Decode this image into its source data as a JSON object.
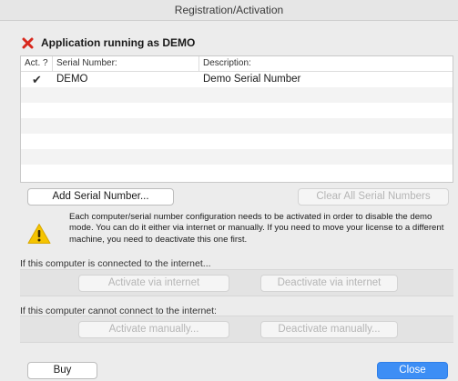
{
  "window": {
    "title": "Registration/Activation"
  },
  "status": {
    "text": "Application running as DEMO",
    "icon": "red-x-icon",
    "icon_color": "#d8281d"
  },
  "table": {
    "headers": {
      "act": "Act. ?",
      "serial": "Serial Number:",
      "description": "Description:"
    },
    "rows": [
      {
        "act": "✔",
        "serial": "DEMO",
        "description": "Demo Serial Number"
      }
    ]
  },
  "buttons": {
    "add_serial": "Add Serial Number...",
    "clear_all": "Clear All Serial Numbers",
    "activate_internet": "Activate via internet",
    "deactivate_internet": "Deactivate via internet",
    "activate_manually": "Activate manually...",
    "deactivate_manually": "Deactivate manually...",
    "buy": "Buy",
    "close": "Close"
  },
  "info": {
    "icon": "warning-icon",
    "text": "Each computer/serial number configuration needs to be activated in order to disable the demo mode. You can do it either via internet or manually. If you need to move your license to a different machine, you need to deactivate this one first."
  },
  "sections": {
    "internet": "If this computer is connected to the internet...",
    "manual": "If this computer cannot connect to the internet:"
  },
  "colors": {
    "accent": "#3d8ef5",
    "warning": "#f5c400"
  }
}
